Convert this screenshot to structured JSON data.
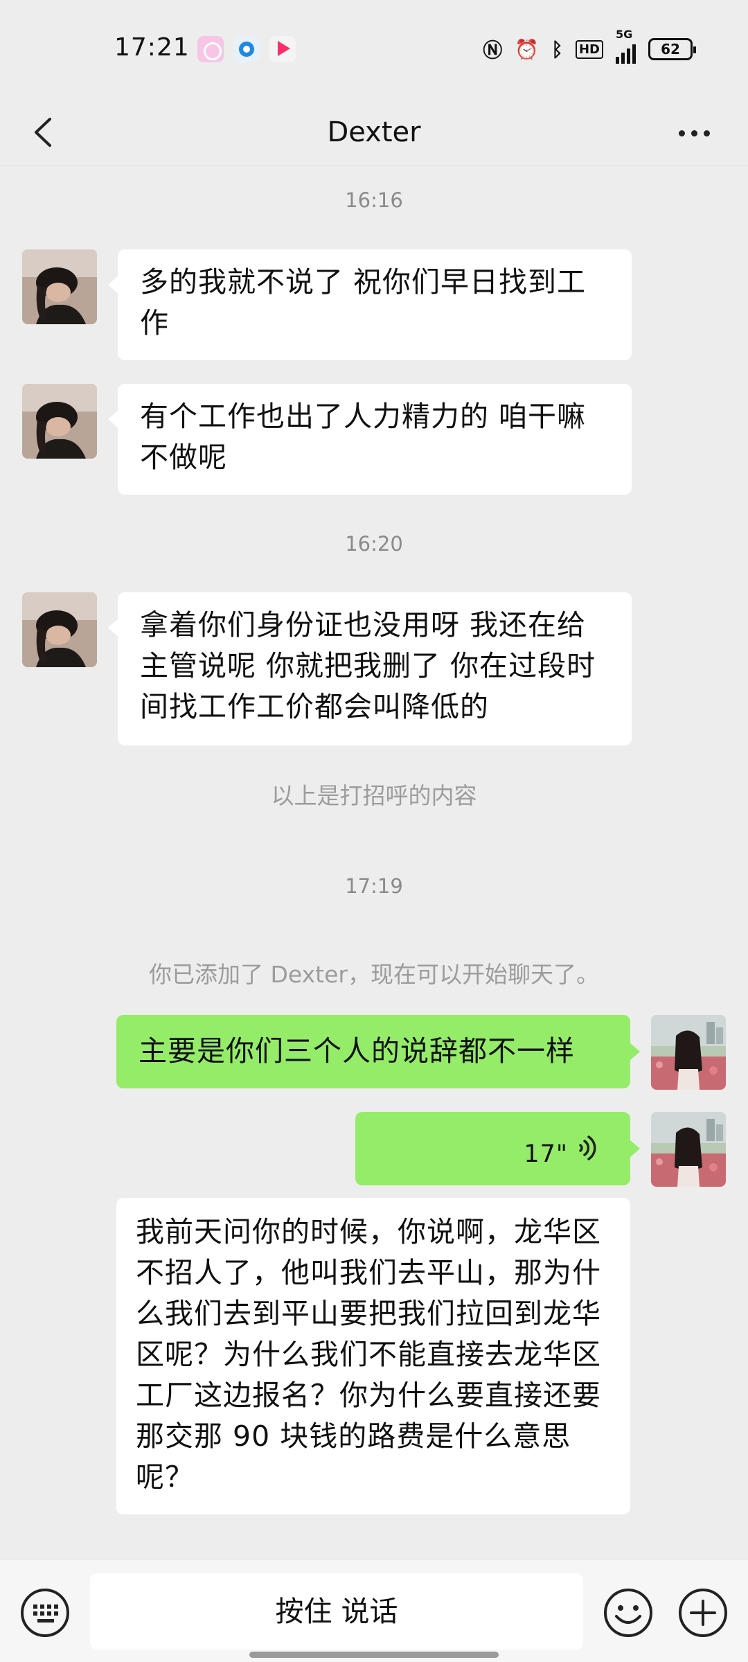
{
  "status_bar": {
    "time": "17:21",
    "notification_icons": [
      "photos-icon",
      "browser-icon",
      "youku-icon"
    ],
    "network": "5G",
    "hd": "HD",
    "battery": "62"
  },
  "nav": {
    "title": "Dexter"
  },
  "messages": {
    "time_1": "16:16",
    "msg_1": "多的我就不说了 祝你们早日找到工作",
    "msg_2": "有个工作也出了人力精力的 咱干嘛不做呢",
    "time_2": "16:20",
    "msg_3": "拿着你们身份证也没用呀 我还在给主管说呢 你就把我删了 你在过段时间找工作工价都会叫降低的",
    "greeting_note": "以上是打招呼的内容",
    "time_3": "17:19",
    "added_note": "你已添加了 Dexter，现在可以开始聊天了。",
    "msg_4": "主要是你们三个人的说辞都不一样",
    "voice_duration": "17\"",
    "msg_6": "我前天问你的时候，你说啊，龙华区不招人了，他叫我们去平山，那为什么我们去到平山要把我们拉回到龙华区呢？为什么我们不能直接去龙华区工厂这边报名？你为什么要直接还要那交那 90 块钱的路费是什么意思呢？"
  },
  "input_bar": {
    "hold_to_talk": "按住 说话"
  },
  "colors": {
    "background": "#ededed",
    "sent_bubble": "#95ec69",
    "received_bubble": "#ffffff"
  }
}
